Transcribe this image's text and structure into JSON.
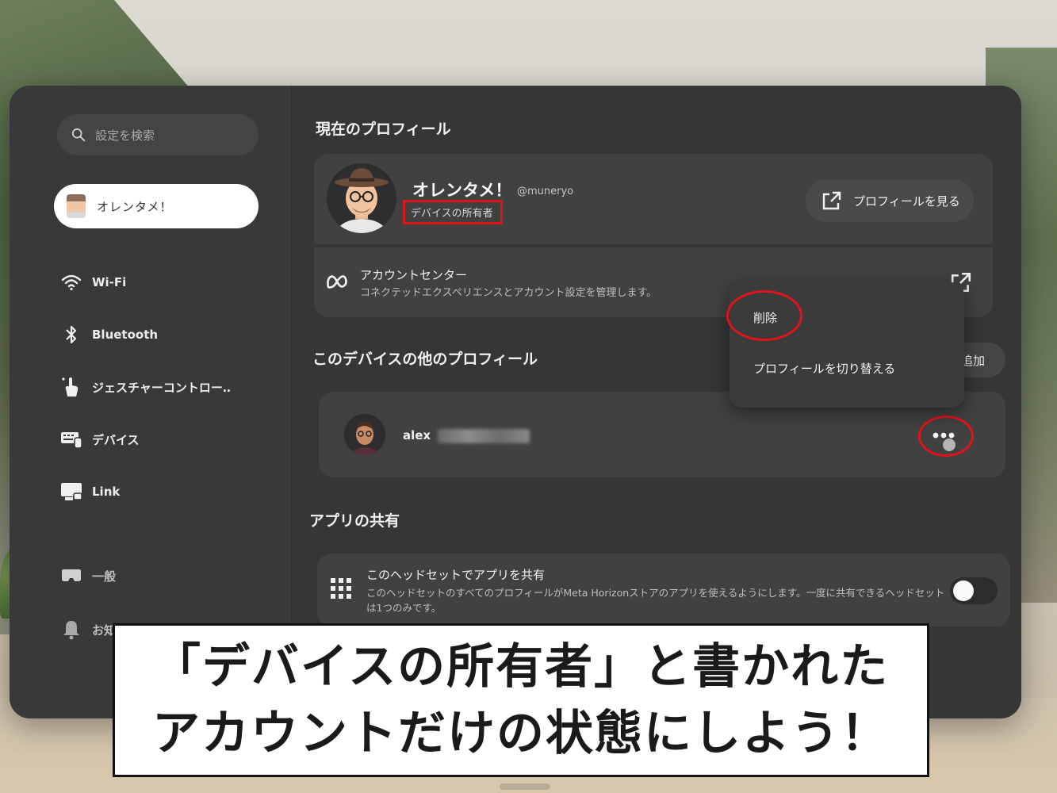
{
  "search": {
    "placeholder": "設定を検索"
  },
  "sidebar": {
    "profile_name": "オレンタメ！",
    "items": [
      {
        "label": "Wi-Fi",
        "icon": "wifi-icon"
      },
      {
        "label": "Bluetooth",
        "icon": "bluetooth-icon"
      },
      {
        "label": "ジェスチャーコントロー‥",
        "icon": "hand-gesture-icon"
      },
      {
        "label": "デバイス",
        "icon": "device-icon"
      },
      {
        "label": "Link",
        "icon": "link-icon"
      },
      {
        "label": "一般",
        "icon": "headset-icon"
      },
      {
        "label": "お知",
        "icon": "bell-icon"
      }
    ]
  },
  "current_profile": {
    "section_title": "現在のプロフィール",
    "name": "オレンタメ！",
    "handle": "@muneryo",
    "role": "デバイスの所有者",
    "view_button": "プロフィールを見る"
  },
  "account_center": {
    "title": "アカウントセンター",
    "description": "コネクテッドエクスペリエンスとアカウント設定を管理します。"
  },
  "context_menu": {
    "items": [
      "削除",
      "プロフィールを切り替える"
    ]
  },
  "other_profiles": {
    "section_title": "このデバイスの他のプロフィール",
    "add_label": "追加",
    "profiles": [
      {
        "name": "alex"
      }
    ]
  },
  "app_sharing": {
    "section_title": "アプリの共有",
    "title": "このヘッドセットでアプリを共有",
    "description": "このヘッドセットのすべてのプロフィールがMeta Horizonストアのアプリを使えるようにします。一度に共有できるヘッドセットは1つのみです。",
    "enabled": false
  },
  "caption": {
    "line1": "「デバイスの所有者」と書かれた",
    "line2": "アカウントだけの状態にしよう！"
  },
  "colors": {
    "highlight": "#e0131b",
    "panel": "#3a3a3b",
    "card": "#414142"
  }
}
